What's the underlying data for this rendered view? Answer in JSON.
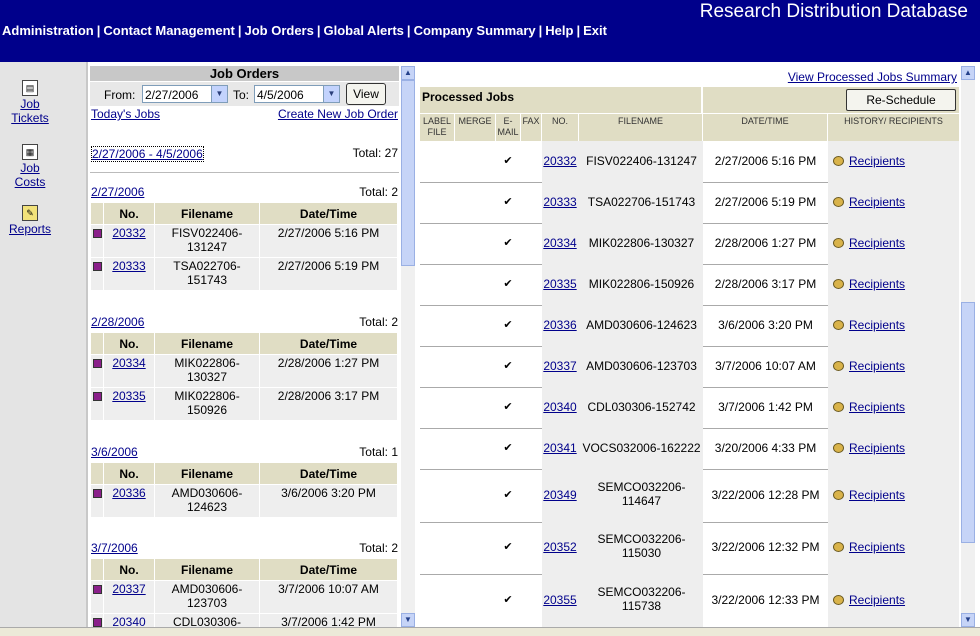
{
  "app_title": "Research Distribution Database",
  "nav": [
    {
      "label": "Administration"
    },
    {
      "label": "Contact Management"
    },
    {
      "label": "Job Orders"
    },
    {
      "label": "Global Alerts"
    },
    {
      "label": "Company Summary"
    },
    {
      "label": "Help"
    },
    {
      "label": "Exit"
    }
  ],
  "nav_sep": "|",
  "sidebar": {
    "job_tickets": {
      "line1": "Job",
      "line2": "Tickets",
      "icon": "ticket-icon"
    },
    "job_costs": {
      "line1": "Job",
      "line2": "Costs",
      "icon": "calculator-icon"
    },
    "reports": {
      "label": "Reports",
      "icon": "reports-icon"
    }
  },
  "job_orders": {
    "title": "Job Orders",
    "from_label": "From:",
    "from_value": "2/27/2006",
    "to_label": "To:",
    "to_value": "4/5/2006",
    "view_label": "View",
    "todays_jobs": "Today's Jobs",
    "create_new": "Create New Job Order",
    "range_link": "2/27/2006 - 4/5/2006",
    "range_total": "Total: 27",
    "columns": {
      "no": "No.",
      "filename": "Filename",
      "datetime": "Date/Time"
    },
    "groups": [
      {
        "date": "2/27/2006",
        "total": "Total: 2",
        "rows": [
          {
            "no": "20332",
            "file1": "FISV022406-",
            "file2": "131247",
            "datetime": "2/27/2006 5:16 PM"
          },
          {
            "no": "20333",
            "file1": "TSA022706-",
            "file2": "151743",
            "datetime": "2/27/2006 5:19 PM"
          }
        ]
      },
      {
        "date": "2/28/2006",
        "total": "Total: 2",
        "rows": [
          {
            "no": "20334",
            "file1": "MIK022806-",
            "file2": "130327",
            "datetime": "2/28/2006 1:27 PM"
          },
          {
            "no": "20335",
            "file1": "MIK022806-",
            "file2": "150926",
            "datetime": "2/28/2006 3:17 PM"
          }
        ]
      },
      {
        "date": "3/6/2006",
        "total": "Total: 1",
        "rows": [
          {
            "no": "20336",
            "file1": "AMD030606-",
            "file2": "124623",
            "datetime": "3/6/2006 3:20 PM"
          }
        ]
      },
      {
        "date": "3/7/2006",
        "total": "Total: 2",
        "rows": [
          {
            "no": "20337",
            "file1": "AMD030606-",
            "file2": "123703",
            "datetime": "3/7/2006 10:07 AM"
          },
          {
            "no": "20340",
            "file1": "CDL030306-",
            "file2": "",
            "datetime": "3/7/2006 1:42 PM"
          }
        ]
      }
    ]
  },
  "processed": {
    "summary_link": "View Processed Jobs Summary",
    "title": "Processed Jobs",
    "reschedule_label": "Re-Schedule",
    "columns": {
      "label_file": "LABEL FILE",
      "merge": "MERGE",
      "email": "E-MAIL",
      "fax": "FAX",
      "no": "NO.",
      "filename": "FILENAME",
      "datetime": "DATE/TIME",
      "history": "HISTORY/ RECIPIENTS"
    },
    "check": "✔",
    "recipients_label": "Recipients",
    "rows": [
      {
        "no": "20332",
        "file1": "FISV022406-131247",
        "file2": "",
        "datetime": "2/27/2006 5:16 PM"
      },
      {
        "no": "20333",
        "file1": "TSA022706-151743",
        "file2": "",
        "datetime": "2/27/2006 5:19 PM"
      },
      {
        "no": "20334",
        "file1": "MIK022806-130327",
        "file2": "",
        "datetime": "2/28/2006 1:27 PM"
      },
      {
        "no": "20335",
        "file1": "MIK022806-150926",
        "file2": "",
        "datetime": "2/28/2006 3:17 PM"
      },
      {
        "no": "20336",
        "file1": "AMD030606-124623",
        "file2": "",
        "datetime": "3/6/2006 3:20 PM"
      },
      {
        "no": "20337",
        "file1": "AMD030606-123703",
        "file2": "",
        "datetime": "3/7/2006 10:07 AM"
      },
      {
        "no": "20340",
        "file1": "CDL030306-152742",
        "file2": "",
        "datetime": "3/7/2006 1:42 PM"
      },
      {
        "no": "20341",
        "file1": "VOCS032006-162222",
        "file2": "",
        "datetime": "3/20/2006 4:33 PM"
      },
      {
        "no": "20349",
        "file1": "SEMCO032206-",
        "file2": "114647",
        "datetime": "3/22/2006 12:28 PM"
      },
      {
        "no": "20352",
        "file1": "SEMCO032206-",
        "file2": "115030",
        "datetime": "3/22/2006 12:32 PM"
      },
      {
        "no": "20355",
        "file1": "SEMCO032206-",
        "file2": "115738",
        "datetime": "3/22/2006 12:33 PM"
      }
    ]
  },
  "colors": {
    "header_bg": "#00008b",
    "link": "#00008b",
    "table_header": "#e0ddc4"
  }
}
